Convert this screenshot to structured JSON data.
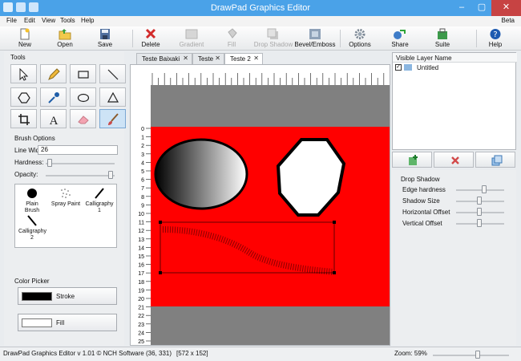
{
  "window": {
    "title": "DrawPad Graphics Editor",
    "min": "–",
    "max": "▢",
    "close": "✕"
  },
  "menu": {
    "items": [
      "File",
      "Edit",
      "View",
      "Tools",
      "Help"
    ],
    "beta": "Beta"
  },
  "toolbar": {
    "new": "New",
    "open": "Open",
    "save": "Save",
    "delete": "Delete",
    "gradient": "Gradient",
    "fill": "Fill",
    "drop_shadow": "Drop Shadow",
    "bevel_emboss": "Bevel/Emboss",
    "options": "Options",
    "share": "Share",
    "suite": "Suite",
    "help": "Help"
  },
  "tools": {
    "label": "Tools"
  },
  "brush_options": {
    "label": "Brush Options",
    "line_width_label": "Line Width:",
    "line_width": "26",
    "hardness_label": "Hardness:",
    "opacity_label": "Opacity:",
    "hardness": 0.05,
    "opacity": 0.95,
    "brushes": [
      "Plain Brush",
      "Spray Paint",
      "Calligraphy 1",
      "Calligraphy 2"
    ]
  },
  "color_picker": {
    "label": "Color Picker",
    "stroke": "Stroke",
    "fill": "Fill",
    "stroke_color": "#000000",
    "fill_color": "#ffffff"
  },
  "tabs": [
    "Teste Baixaki",
    "Teste",
    "Teste 2"
  ],
  "ruler": {
    "vertical": [
      "0",
      "1",
      "2",
      "3",
      "4",
      "5",
      "6",
      "7",
      "8",
      "9",
      "10",
      "11",
      "12",
      "13",
      "14",
      "15",
      "16",
      "17",
      "18",
      "19",
      "20",
      "21",
      "22",
      "23",
      "24",
      "25"
    ]
  },
  "canvas_colors": {
    "background": "#ff0000",
    "outside": "#808080"
  },
  "layers": {
    "visible_header": "Visible",
    "name_header": "Layer Name",
    "row_name": "Untitled"
  },
  "drop_shadow": {
    "label": "Drop Shadow",
    "edge_hardness_label": "Edge hardness",
    "shadow_size_label": "Shadow Size",
    "horizontal_offset_label": "Horizontal Offset",
    "vertical_offset_label": "Vertical Offset",
    "edge_hardness": 0.75,
    "shadow_size": 0.5,
    "horizontal_offset": 0.5,
    "vertical_offset": 0.5
  },
  "status": {
    "version": "DrawPad Graphics Editor v 1.01 © NCH Software",
    "position": "(36, 331)",
    "size": "[572 x 152]",
    "zoom_label": "Zoom: 59%",
    "zoom": 0.59
  }
}
